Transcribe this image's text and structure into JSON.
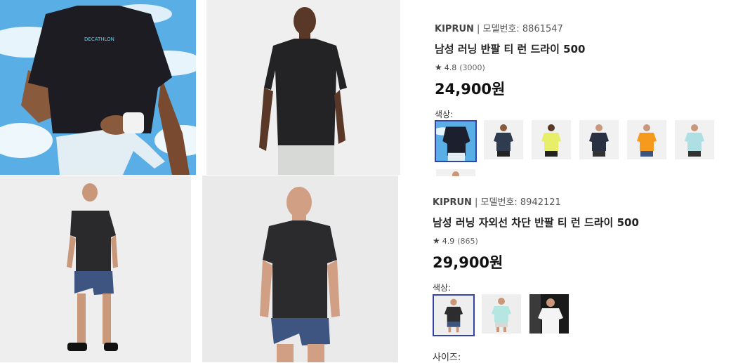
{
  "products": [
    {
      "brand": "KIPRUN",
      "model_label": "모델번호: 8861547",
      "name": "남성 러닝 반팔 티 런 드라이 500",
      "rating": "4.8",
      "review_count": "(3000)",
      "price": "24,900원",
      "color_label": "색상:",
      "swatches": [
        {
          "name": "sky-photo",
          "color": "#1b1f2e",
          "selected": true
        },
        {
          "name": "navy",
          "color": "#2f3b4e",
          "selected": false
        },
        {
          "name": "lime",
          "color": "#e6ee6a",
          "selected": false
        },
        {
          "name": "dark-navy",
          "color": "#2a3142",
          "selected": false
        },
        {
          "name": "orange",
          "color": "#f59a1c",
          "selected": false
        },
        {
          "name": "mint",
          "color": "#aee0e3",
          "selected": false
        },
        {
          "name": "partial",
          "color": "#d9d9d9",
          "selected": false
        }
      ]
    },
    {
      "brand": "KIPRUN",
      "model_label": "모델번호: 8942121",
      "name": "남성 러닝 자외선 차단 반팔 티 런 드라이 500",
      "rating": "4.9",
      "review_count": "(865)",
      "price": "29,900원",
      "color_label": "색상:",
      "size_label": "사이즈:",
      "swatches": [
        {
          "name": "dark-gray",
          "color": "#2d2d2f",
          "selected": true
        },
        {
          "name": "mint",
          "color": "#b5e6e2",
          "selected": false
        },
        {
          "name": "white-photo",
          "color": "#f4f4f4",
          "selected": false
        }
      ]
    }
  ],
  "photo_logo_text": "DECATHLON",
  "colors": {
    "selected_border": "#3343a8",
    "sky": "#5aaee6",
    "shirt": "#232325",
    "shorts_blue": "#3d5580",
    "shorts_gray": "#d7d9d6"
  }
}
